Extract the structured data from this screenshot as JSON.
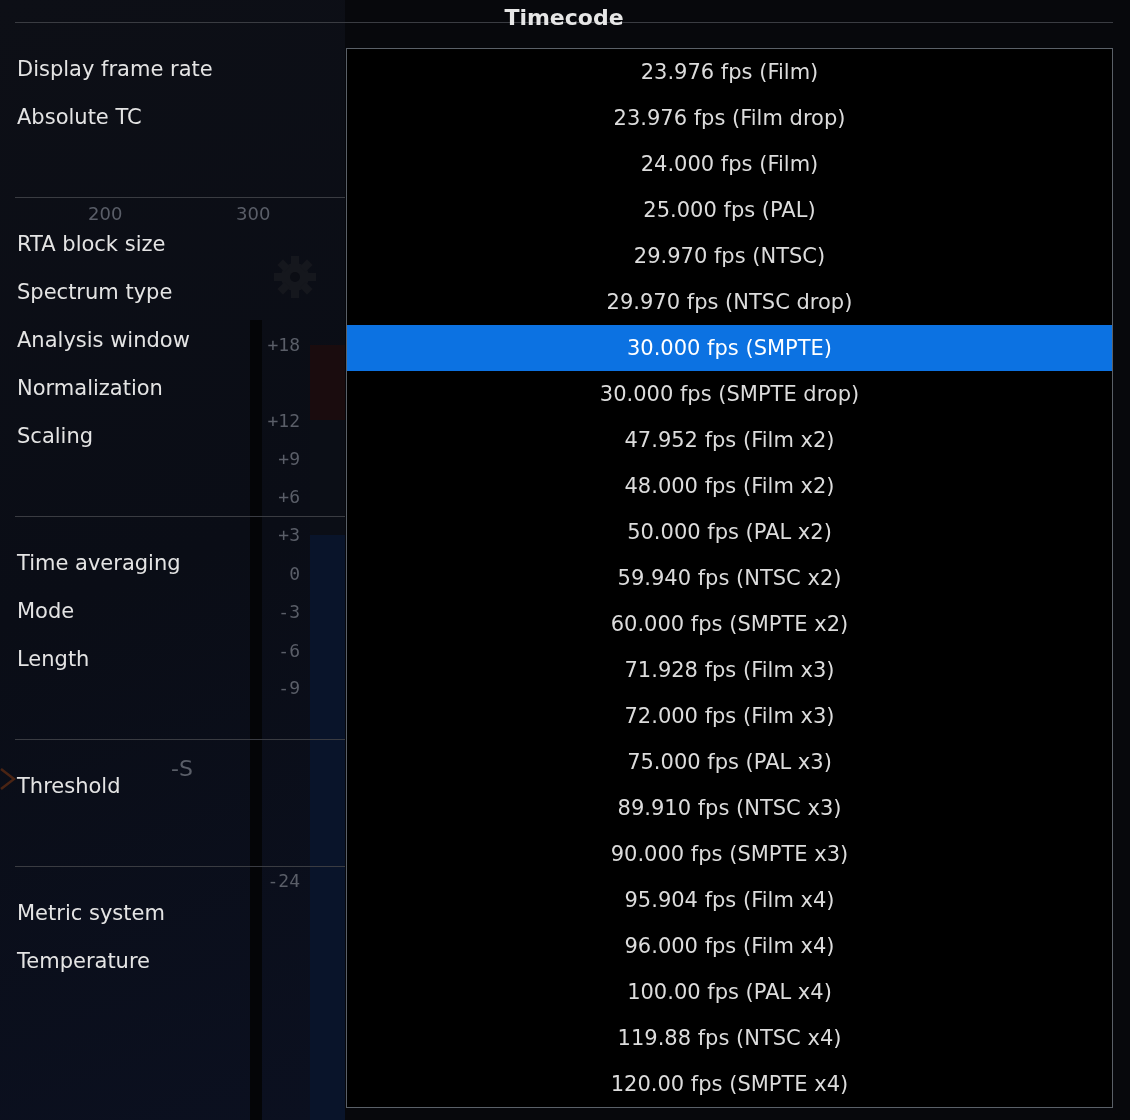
{
  "title": "Timecode",
  "background": {
    "axis_labels": [
      "200",
      "300"
    ],
    "scale_labels": [
      "+18",
      "+12",
      "+9",
      "+6",
      "+3",
      "0",
      "-3",
      "-6",
      "-9",
      "-24"
    ],
    "marker_label": "-S"
  },
  "settings_groups": [
    {
      "labels": [
        "Display frame rate",
        "Absolute TC"
      ]
    },
    {
      "labels": [
        "RTA block size",
        "Spectrum type",
        "Analysis window",
        "Normalization",
        "Scaling"
      ]
    },
    {
      "labels": [
        "Time averaging",
        "Mode",
        "Length"
      ]
    },
    {
      "labels": [
        "Threshold"
      ]
    },
    {
      "labels": [
        "Metric system",
        "Temperature"
      ]
    }
  ],
  "dropdown": {
    "options": [
      {
        "label": "23.976 fps (Film)",
        "selected": false
      },
      {
        "label": "23.976 fps (Film drop)",
        "selected": false
      },
      {
        "label": "24.000 fps (Film)",
        "selected": false
      },
      {
        "label": "25.000 fps (PAL)",
        "selected": false
      },
      {
        "label": "29.970 fps (NTSC)",
        "selected": false
      },
      {
        "label": "29.970 fps (NTSC drop)",
        "selected": false
      },
      {
        "label": "30.000 fps (SMPTE)",
        "selected": true
      },
      {
        "label": "30.000 fps (SMPTE drop)",
        "selected": false
      },
      {
        "label": "47.952 fps (Film x2)",
        "selected": false
      },
      {
        "label": "48.000 fps (Film x2)",
        "selected": false
      },
      {
        "label": "50.000 fps (PAL x2)",
        "selected": false
      },
      {
        "label": "59.940 fps (NTSC x2)",
        "selected": false
      },
      {
        "label": "60.000 fps (SMPTE x2)",
        "selected": false
      },
      {
        "label": "71.928 fps (Film x3)",
        "selected": false
      },
      {
        "label": "72.000 fps (Film x3)",
        "selected": false
      },
      {
        "label": "75.000 fps (PAL x3)",
        "selected": false
      },
      {
        "label": "89.910 fps (NTSC x3)",
        "selected": false
      },
      {
        "label": "90.000 fps (SMPTE x3)",
        "selected": false
      },
      {
        "label": "95.904 fps (Film x4)",
        "selected": false
      },
      {
        "label": "96.000 fps (Film x4)",
        "selected": false
      },
      {
        "label": "100.00 fps (PAL x4)",
        "selected": false
      },
      {
        "label": "119.88 fps (NTSC x4)",
        "selected": false
      },
      {
        "label": "120.00 fps (SMPTE x4)",
        "selected": false
      }
    ]
  }
}
